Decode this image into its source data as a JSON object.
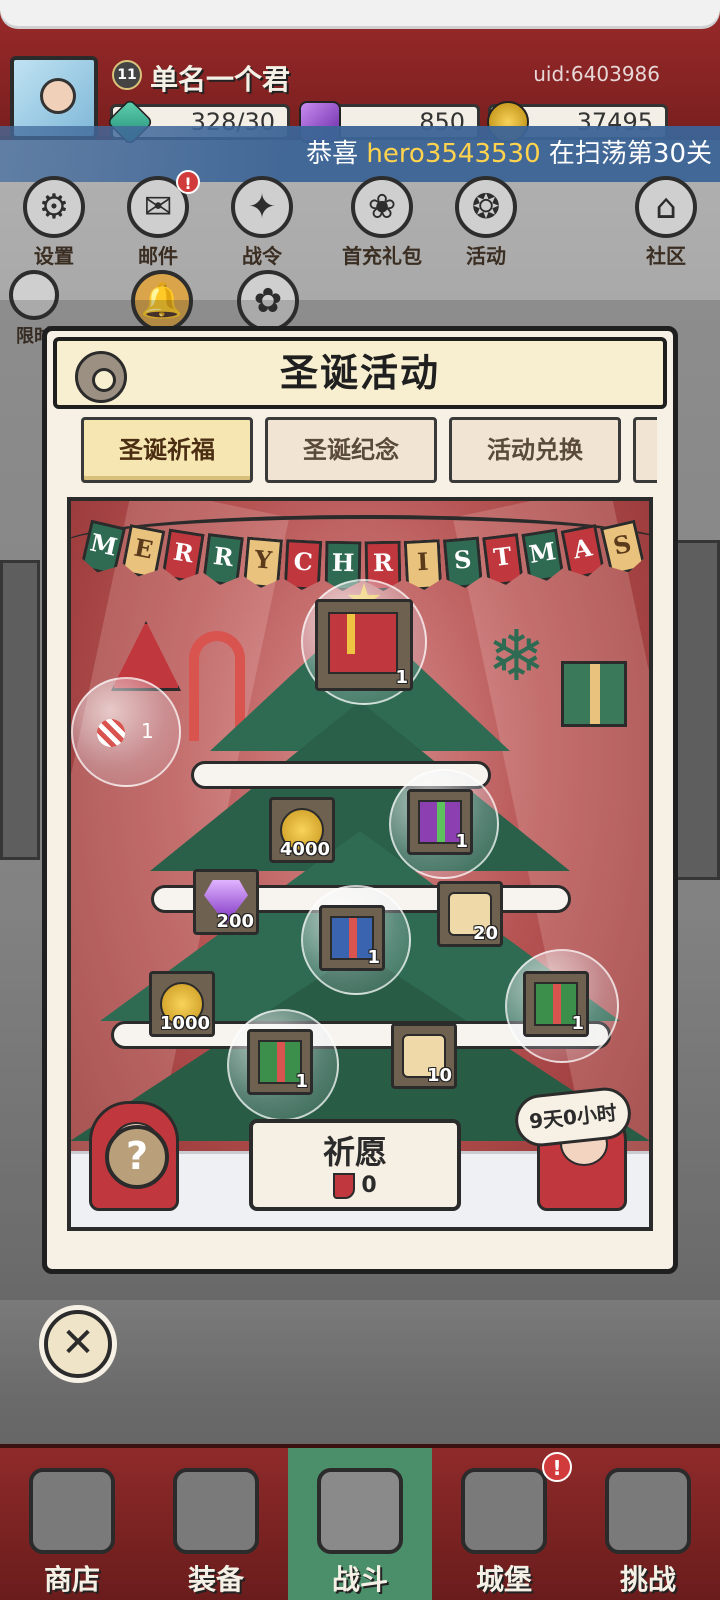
{
  "player": {
    "name": "单名一个君",
    "level": "11",
    "uid": "uid:6403986"
  },
  "resources": {
    "energy": "328/30",
    "gems": "850",
    "gold": "37495"
  },
  "ticker": {
    "prefix": "恭喜",
    "player": "hero3543530",
    "suffix": "在扫荡第30关"
  },
  "menu": {
    "row1": [
      {
        "label": "设置",
        "icon": "gear-icon"
      },
      {
        "label": "邮件",
        "icon": "mail-icon"
      },
      {
        "label": "战令",
        "icon": "battle-pass-icon"
      },
      {
        "label": "首充礼包",
        "icon": "first-recharge-icon"
      },
      {
        "label": "活动",
        "icon": "events-icon"
      },
      {
        "label": "社区",
        "icon": "community-icon"
      }
    ],
    "row2_partial_label": "限时"
  },
  "panel": {
    "title": "圣诞活动",
    "tabs": [
      {
        "label": "圣诞祈福",
        "active": true
      },
      {
        "label": "圣诞纪念",
        "active": false
      },
      {
        "label": "活动兑换",
        "active": false
      }
    ],
    "banner_letters": [
      "M",
      "E",
      "R",
      "R",
      "Y",
      "C",
      "H",
      "R",
      "I",
      "S",
      "T",
      "M",
      "A",
      "S"
    ],
    "rewards": [
      {
        "type": "gift-red",
        "qty": "1"
      },
      {
        "type": "candy-cane",
        "qty": "1"
      },
      {
        "type": "gold-coin",
        "qty": "4000"
      },
      {
        "type": "gift-purple",
        "qty": "1"
      },
      {
        "type": "gem",
        "qty": "200"
      },
      {
        "type": "gift-blue",
        "qty": "1"
      },
      {
        "type": "scroll",
        "qty": "20"
      },
      {
        "type": "gold-coin",
        "qty": "1000"
      },
      {
        "type": "gift-green",
        "qty": "1"
      },
      {
        "type": "scroll",
        "qty": "10"
      },
      {
        "type": "gift-green",
        "qty": "1"
      }
    ],
    "wish": {
      "label": "祈愿",
      "cost": "0"
    },
    "timer": "9天0小时"
  },
  "bottom_nav": [
    {
      "label": "商店",
      "icon": "shop-icon",
      "active": false
    },
    {
      "label": "装备",
      "icon": "equipment-icon",
      "active": false
    },
    {
      "label": "战斗",
      "icon": "crossed-swords-icon",
      "active": true
    },
    {
      "label": "城堡",
      "icon": "castle-icon",
      "active": false,
      "badge": "!"
    },
    {
      "label": "挑战",
      "icon": "challenge-icon",
      "active": false
    }
  ],
  "colors": {
    "accent_red": "#c0383e",
    "tree_green": "#2f6b52",
    "panel_bg": "#f6f1e4",
    "active_nav": "#4b8f6a"
  }
}
